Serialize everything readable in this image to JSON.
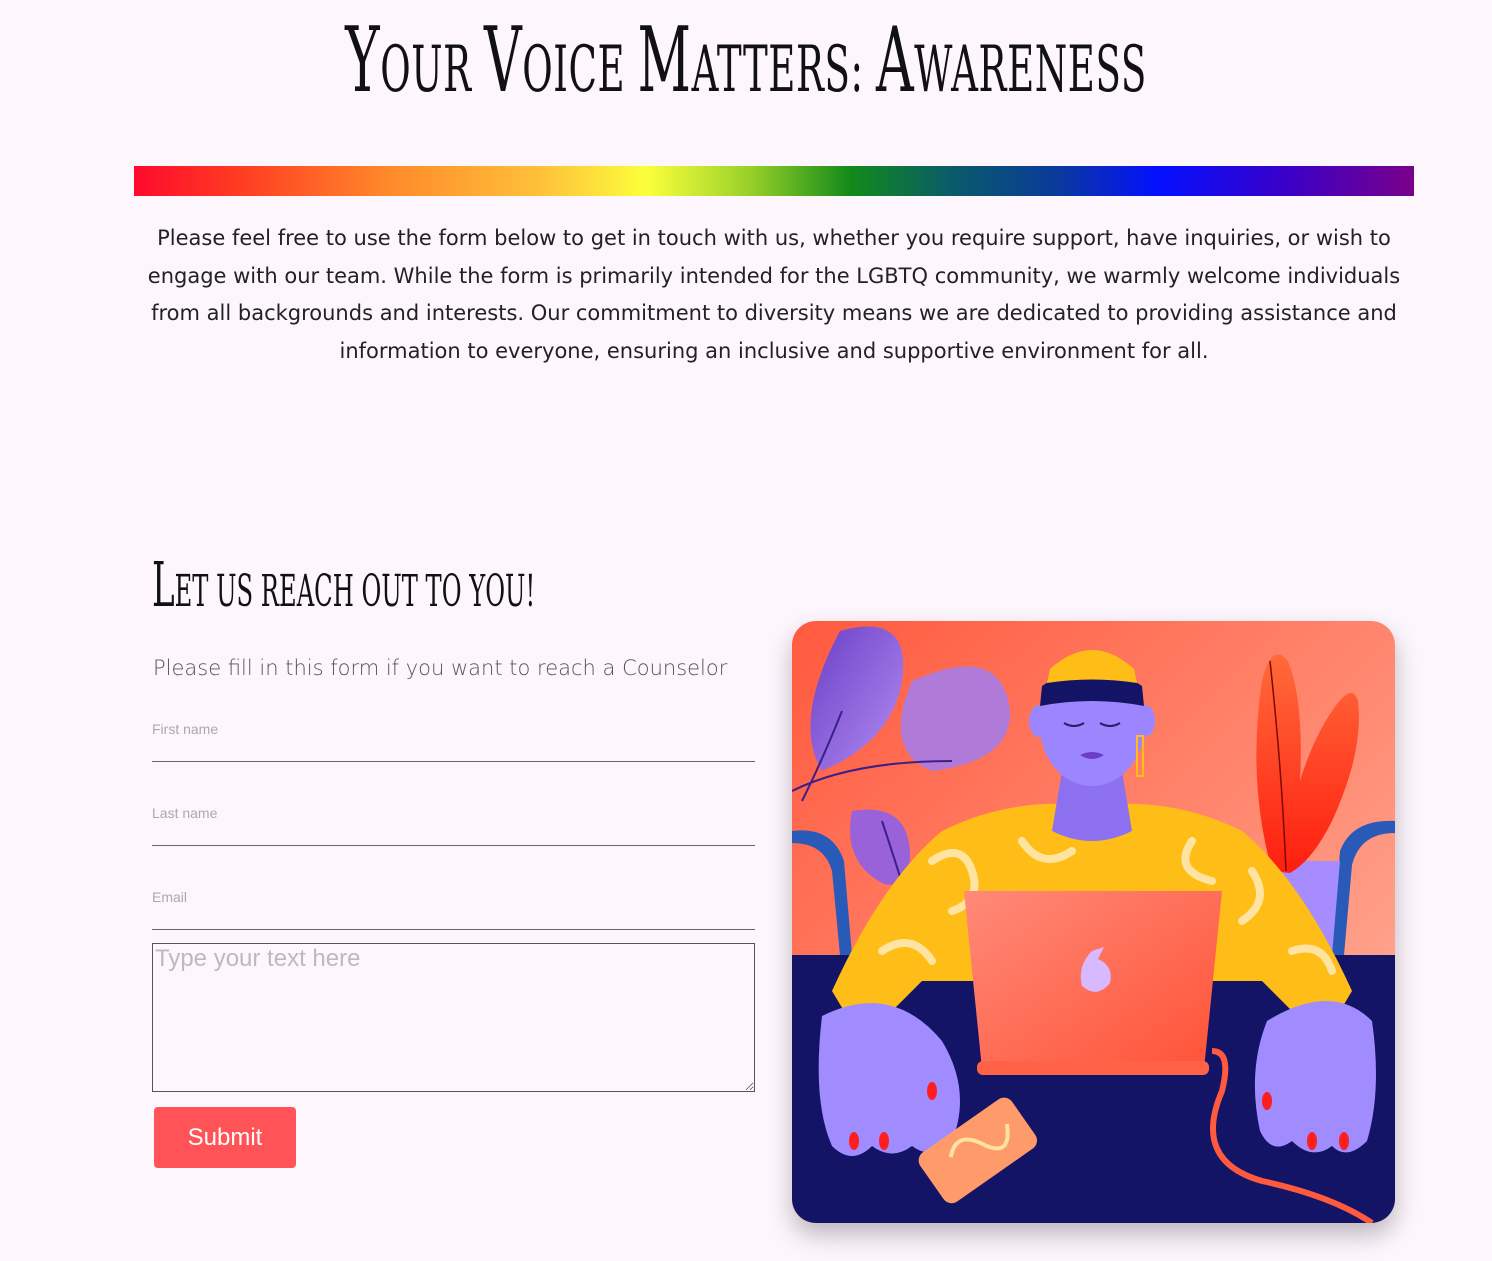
{
  "header": {
    "title_parts": [
      {
        "cap": "Y",
        "rest": "our "
      },
      {
        "cap": "V",
        "rest": "oice "
      },
      {
        "cap": "M",
        "rest": "atters: "
      },
      {
        "cap": "A",
        "rest": "wareness"
      }
    ]
  },
  "intro": {
    "text": "Please feel free to use the form below to get in touch with us, whether you require support, have inquiries, or wish to engage with our team. While the form is primarily intended for the LGBTQ community, we warmly welcome individuals from all backgrounds and interests. Our commitment to diversity means we are dedicated to providing assistance and information to everyone, ensuring an inclusive and supportive environment for all."
  },
  "form": {
    "heading_cap": "L",
    "heading_rest": "et us reach out to you!",
    "subtitle": "Please fill in this form if you want to reach a Counselor",
    "first_name_label": "First name",
    "last_name_label": "Last name",
    "email_label": "Email",
    "message_placeholder": "Type your text here",
    "submit_label": "Submit"
  },
  "colors": {
    "background": "#fdf6fd",
    "submit": "#ff5357",
    "accent_dark": "#141466"
  },
  "illustration": {
    "icon": "person-at-laptop-illustration"
  }
}
